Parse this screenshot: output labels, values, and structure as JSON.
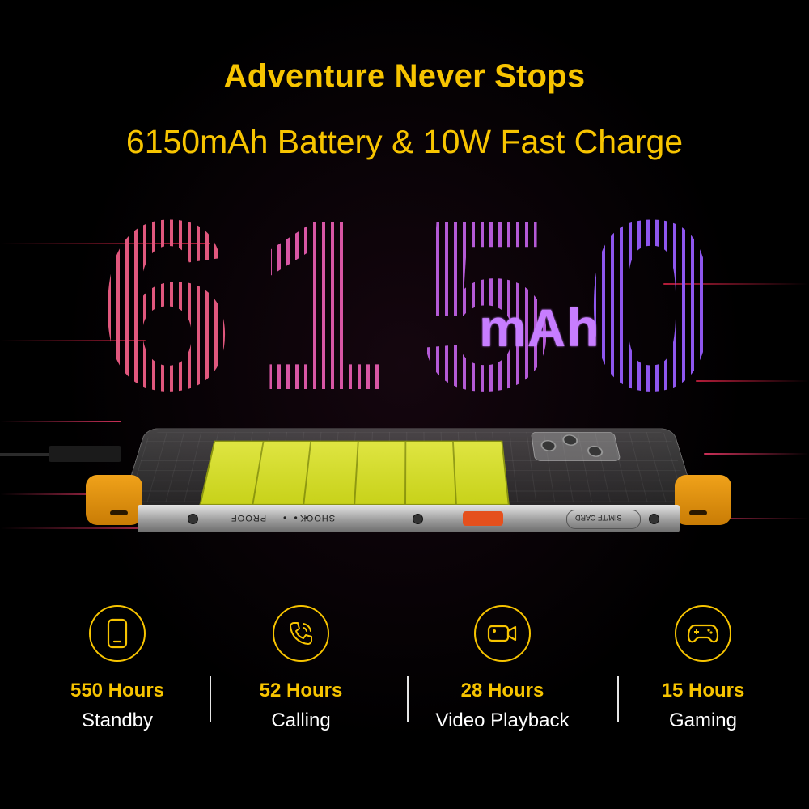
{
  "headline": "Adventure Never Stops",
  "subheadline": "6150mAh Battery & 10W Fast Charge",
  "capacity": {
    "digits": [
      "6",
      "1",
      "5",
      "0"
    ],
    "unit": "mAh"
  },
  "phone": {
    "rail_text_shock": "SHOCK",
    "rail_text_proof": "PROOF",
    "rail_dots": "• • •",
    "sim_slot_label": "SIM/TF CARD"
  },
  "stats": [
    {
      "icon": "phone-icon",
      "value": "550 Hours",
      "label": "Standby"
    },
    {
      "icon": "call-icon",
      "value": "52 Hours",
      "label": "Calling"
    },
    {
      "icon": "video-camera-icon",
      "value": "28 Hours",
      "label": "Video Playback"
    },
    {
      "icon": "gamepad-icon",
      "value": "15 Hours",
      "label": "Gaming"
    }
  ],
  "colors": {
    "accent": "#f7c400",
    "background": "#000000",
    "battery": "#d6dd2c",
    "bumper": "#e8940f"
  }
}
